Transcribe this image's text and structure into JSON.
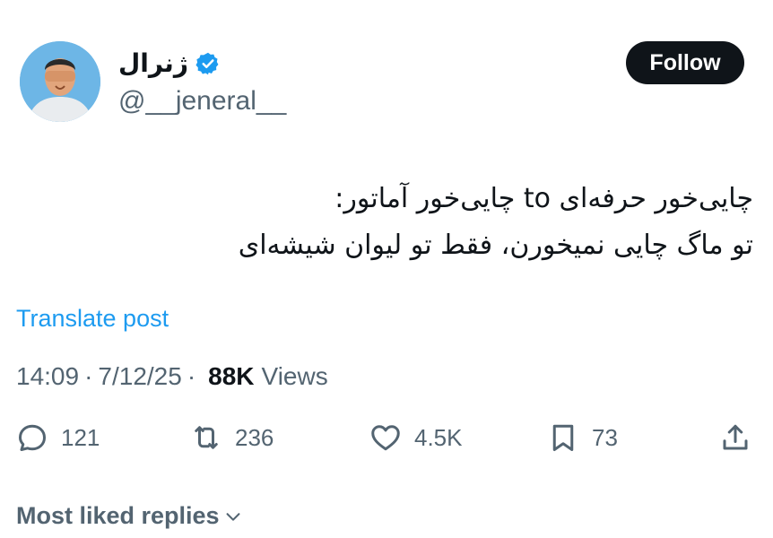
{
  "author": {
    "display_name": "ژنرال",
    "handle": "@__jeneral__",
    "verified": true,
    "avatar_icon": "avatar-photo",
    "verified_color": "#1d9bf0"
  },
  "follow_button": {
    "label": "Follow",
    "bg": "#0f1419",
    "color": "#ffffff"
  },
  "tweet": {
    "lines": [
      "چایی‌خور حرفه‌ای to چایی‌خور آماتور:",
      "تو ماگ چایی نمیخورن، فقط تو لیوان شیشه‌ای"
    ]
  },
  "translate_link": {
    "label": "Translate post",
    "color": "#1d9bf0"
  },
  "meta": {
    "time": "14:09",
    "date": "7/12/25",
    "separator": "·",
    "views_count": "88K",
    "views_label": "Views"
  },
  "actions": {
    "reply": {
      "icon": "reply-icon",
      "count": "121"
    },
    "retweet": {
      "icon": "retweet-icon",
      "count": "236"
    },
    "like": {
      "icon": "heart-icon",
      "count": "4.5K"
    },
    "bookmark": {
      "icon": "bookmark-icon",
      "count": "73"
    },
    "share": {
      "icon": "share-icon"
    }
  },
  "replies_header": {
    "label": "Most liked replies",
    "icon": "chevron-down-icon"
  }
}
